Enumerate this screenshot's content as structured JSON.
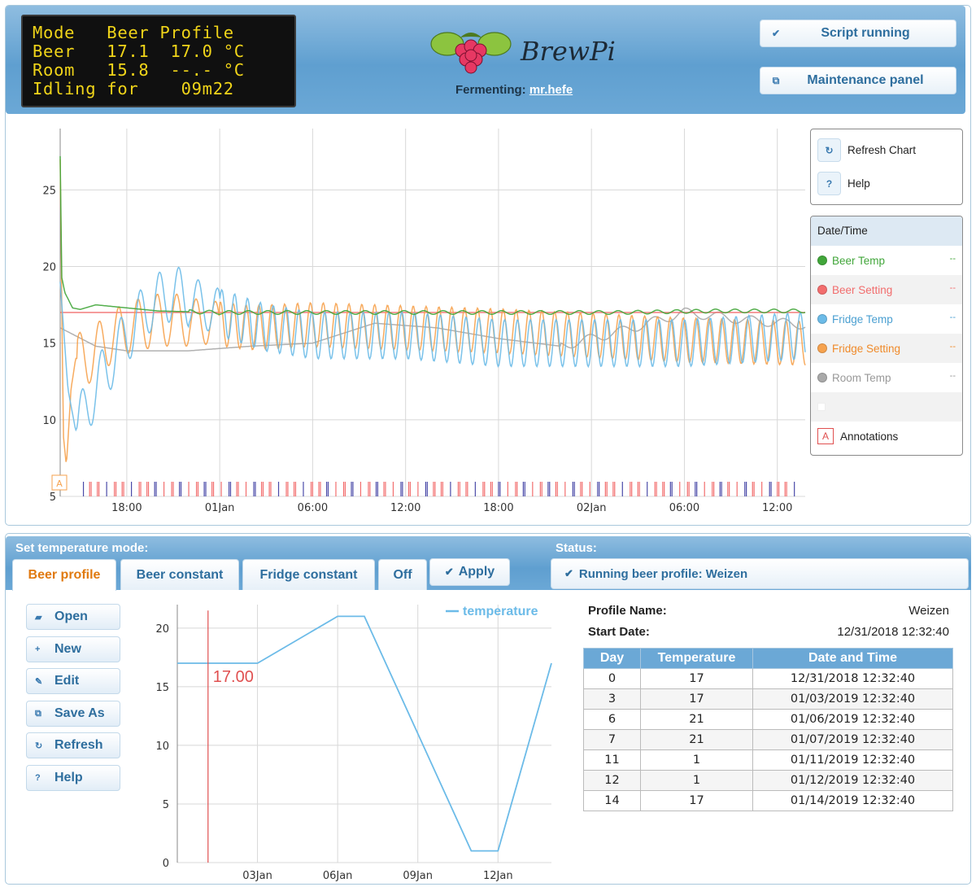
{
  "lcd": {
    "lines": [
      "Mode   Beer Profile",
      "Beer   17.1  17.0 °C",
      "Room   15.8  --.- °C",
      "Idling for    09m22"
    ]
  },
  "header": {
    "logo_text": "BrewPi",
    "fermenting_label": "Fermenting:",
    "fermenting_name": "mr.hefe",
    "script_button": "Script running",
    "maintenance_button": "Maintenance panel"
  },
  "chart_tools": {
    "refresh": "Refresh Chart",
    "help": "Help"
  },
  "legend": {
    "header": "Date/Time",
    "items": [
      {
        "label": "Beer Temp",
        "value": "--",
        "color": "#41a63a"
      },
      {
        "label": "Beer Setting",
        "value": "--",
        "color": "#f26d6d"
      },
      {
        "label": "Fridge Temp",
        "value": "--",
        "color": "#6cbbe8"
      },
      {
        "label": "Fridge Setting",
        "value": "--",
        "color": "#f6a24e"
      },
      {
        "label": "Room Temp",
        "value": "--",
        "color": "#a9a9a9"
      }
    ],
    "annotations_label": "Annotations",
    "annotations_icon": "A"
  },
  "chart_data": [
    {
      "type": "line",
      "x_ticks": [
        "18:00",
        "01Jan",
        "06:00",
        "12:00",
        "18:00",
        "02Jan",
        "06:00",
        "12:00"
      ],
      "y_ticks": [
        5,
        10,
        15,
        20,
        25
      ],
      "ylim": [
        5,
        29
      ],
      "xlim_hours": [
        -4.3,
        43.8
      ],
      "annotation_marker": "A",
      "series": [
        {
          "name": "Beer Temp",
          "color": "#41a63a",
          "x": [
            -4.3,
            -4.2,
            -4.0,
            -3.5,
            -3.0,
            -2.0,
            0,
            2,
            6,
            10,
            16,
            20,
            26,
            32,
            38,
            43.8
          ],
          "y": [
            27.2,
            19.3,
            18.3,
            17.3,
            17.2,
            17.5,
            17.3,
            17.1,
            17.0,
            17.0,
            17.0,
            17.0,
            17.0,
            17.0,
            17.1,
            17.1
          ]
        },
        {
          "name": "Beer Setting",
          "color": "#f26d6d",
          "x": [
            -4.3,
            43.8
          ],
          "y": [
            17.0,
            17.0
          ]
        },
        {
          "name": "Fridge Temp",
          "color": "#6cbbe8",
          "x": [
            -4.3,
            -3.8,
            -3.3,
            -2.5,
            -1.5,
            0,
            1.5,
            3,
            6,
            9,
            12,
            18,
            24,
            30,
            36,
            43.8
          ],
          "y": [
            19.0,
            12.0,
            9.3,
            11.0,
            13.0,
            15.5,
            17.5,
            18.3,
            17.0,
            16.0,
            15.5,
            15.5,
            15.0,
            15.0,
            15.0,
            15.5
          ],
          "amplitude": 1.8
        },
        {
          "name": "Fridge Setting",
          "color": "#f6a24e",
          "x": [
            -4.3,
            -4.1,
            -3.9,
            -3.6,
            -3.3,
            -2.5,
            -1.5,
            0,
            2,
            4,
            8,
            12,
            18,
            24,
            30,
            36,
            43.8
          ],
          "y": [
            27.0,
            9.0,
            7.0,
            12.0,
            14.0,
            14.0,
            15.0,
            16.0,
            16.5,
            16.5,
            16.0,
            16.2,
            16.0,
            15.8,
            15.5,
            15.2,
            15.0
          ],
          "amplitude": 1.7
        },
        {
          "name": "Room Temp",
          "color": "#a9a9a9",
          "x": [
            -4.3,
            -2,
            0,
            4,
            8,
            12,
            16,
            20,
            24,
            28,
            32,
            36,
            40,
            43.8
          ],
          "y": [
            16.0,
            14.8,
            14.5,
            14.5,
            14.8,
            15.0,
            16.3,
            16.0,
            15.3,
            14.8,
            15.8,
            17.0,
            16.5,
            16.2
          ]
        }
      ]
    },
    {
      "type": "line",
      "legend": "temperature",
      "x_ticks": [
        "03Jan",
        "06Jan",
        "09Jan",
        "12Jan"
      ],
      "y_ticks": [
        0,
        5,
        10,
        15,
        20
      ],
      "ylim": [
        0,
        22
      ],
      "xlim_days": [
        0,
        14
      ],
      "current_marker": {
        "day": 1.15,
        "value_label": "17.00"
      },
      "series": [
        {
          "name": "temperature",
          "color": "#6cbbe8",
          "x": [
            0,
            3,
            6,
            7,
            11,
            12,
            14
          ],
          "y": [
            17,
            17,
            21,
            21,
            1,
            1,
            17
          ]
        }
      ]
    }
  ],
  "control": {
    "mode_title": "Set temperature mode:",
    "status_title": "Status:",
    "tabs": [
      "Beer profile",
      "Beer constant",
      "Fridge constant",
      "Off"
    ],
    "apply": "Apply",
    "status_text": "Running beer profile: Weizen",
    "side_buttons": [
      "Open",
      "New",
      "Edit",
      "Save As",
      "Refresh",
      "Help"
    ]
  },
  "profile": {
    "name_label": "Profile Name:",
    "name": "Weizen",
    "start_label": "Start Date:",
    "start_date": "12/31/2018 12:32:40",
    "columns": [
      "Day",
      "Temperature",
      "Date and Time"
    ],
    "rows": [
      [
        "0",
        "17",
        "12/31/2018 12:32:40"
      ],
      [
        "3",
        "17",
        "01/03/2019 12:32:40"
      ],
      [
        "6",
        "21",
        "01/06/2019 12:32:40"
      ],
      [
        "7",
        "21",
        "01/07/2019 12:32:40"
      ],
      [
        "11",
        "1",
        "01/11/2019 12:32:40"
      ],
      [
        "12",
        "1",
        "01/12/2019 12:32:40"
      ],
      [
        "14",
        "17",
        "01/14/2019 12:32:40"
      ]
    ]
  }
}
